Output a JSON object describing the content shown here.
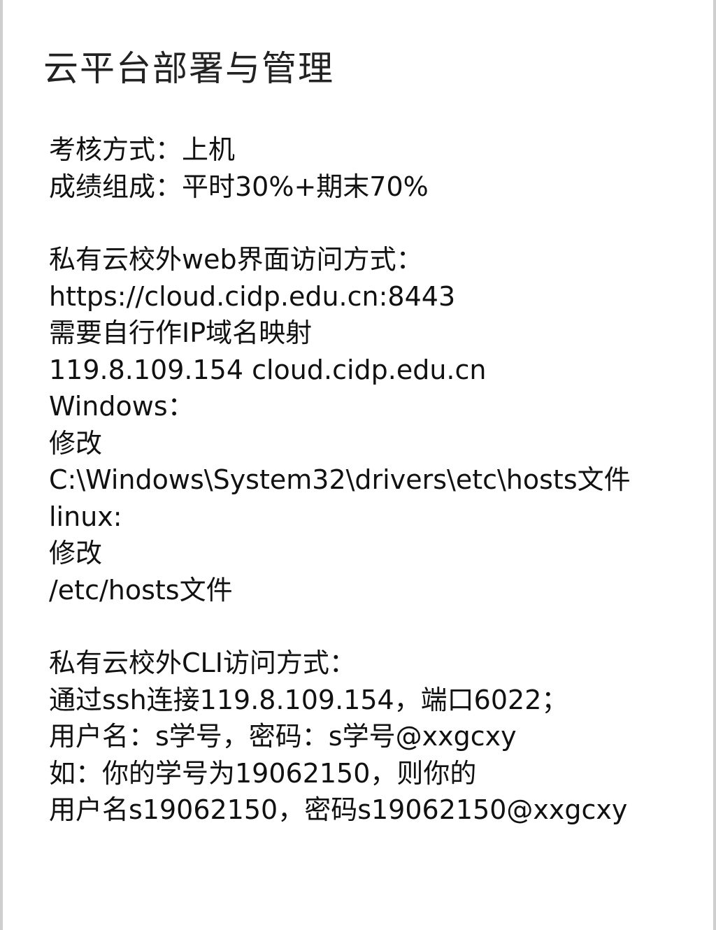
{
  "document": {
    "title": "云平台部署与管理",
    "sections": [
      {
        "lines": [
          "考核方式：上机",
          "成绩组成：平时30%+期末70%"
        ]
      },
      {
        "lines": [
          "私有云校外web界面访问方式：",
          "https://cloud.cidp.edu.cn:8443",
          "需要自行作IP域名映射",
          "119.8.109.154 cloud.cidp.edu.cn",
          "Windows：",
          "修改",
          "C:\\Windows\\System32\\drivers\\etc\\hosts文件",
          "linux:",
          "修改",
          "/etc/hosts文件"
        ]
      },
      {
        "lines": [
          "私有云校外CLI访问方式：",
          "通过ssh连接119.8.109.154，端口6022；",
          "用户名：s学号，密码：s学号@xxgcxy",
          "如：你的学号为19062150，则你的",
          "用户名s19062150，密码s19062150@xxgcxy"
        ]
      }
    ]
  }
}
